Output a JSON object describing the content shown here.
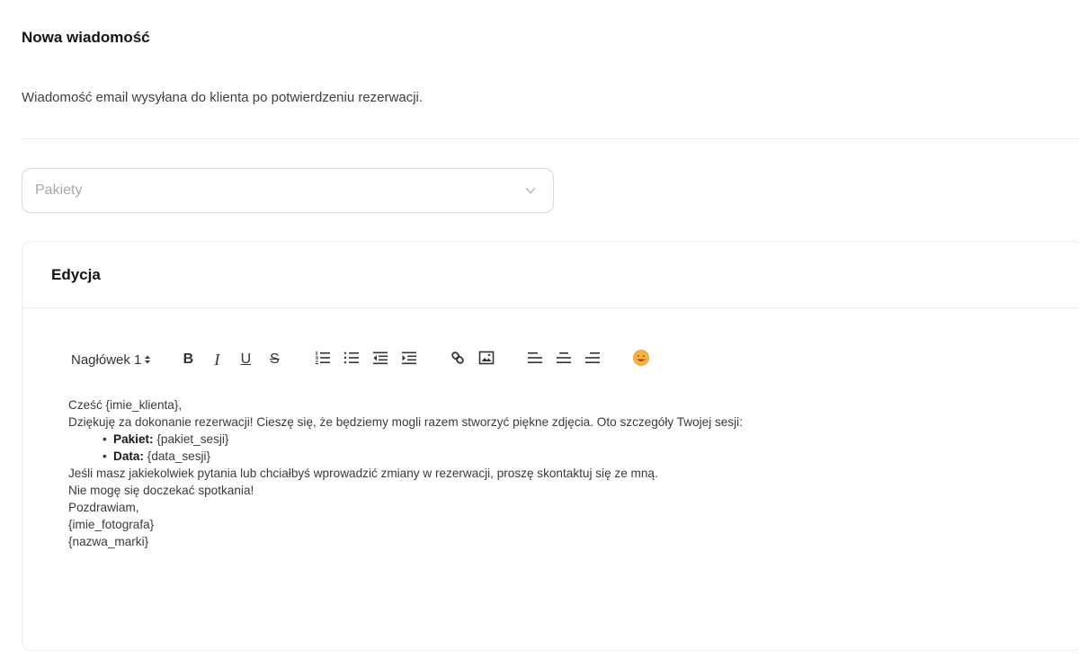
{
  "header": {
    "title": "Nowa wiadomość",
    "subtitle": "Wiadomość email wysyłana do klienta po potwierdzeniu rezerwacji."
  },
  "package_select": {
    "placeholder": "Pakiety"
  },
  "editor_card": {
    "title": "Edycja",
    "toolbar": {
      "heading_select": "Nagłówek 1",
      "bold": "B",
      "italic": "I",
      "underline": "U",
      "strike": "S"
    },
    "content": {
      "greeting": "Cześć {imie_klienta},",
      "intro": "Dziękuję za dokonanie rezerwacji! Cieszę się, że będziemy mogli razem stworzyć piękne zdjęcia. Oto szczegóły Twojej sesji:",
      "details": [
        {
          "label": "Pakiet:",
          "value": " {pakiet_sesji}"
        },
        {
          "label": "Data:",
          "value": " {data_sesji}"
        }
      ],
      "questions": "Jeśli masz jakiekolwiek pytania lub chciałbyś wprowadzić zmiany w rezerwacji, proszę skontaktuj się ze mną.",
      "closing": "Nie mogę się doczekać spotkania!",
      "signoff": "Pozdrawiam,",
      "photographer": "{imie_fotografa}",
      "brand": "{nazwa_marki}"
    }
  },
  "colors": {
    "border": "#d9d9d9",
    "placeholder": "#a8a8a8",
    "divider": "#ececec",
    "emoji": "#f5a623"
  }
}
